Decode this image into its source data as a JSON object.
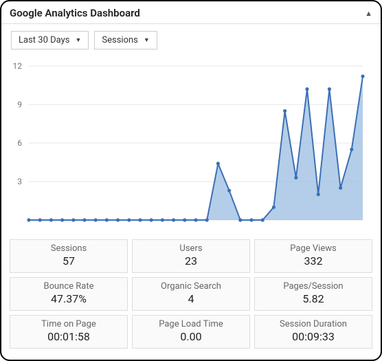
{
  "header": {
    "title": "Google Analytics Dashboard"
  },
  "controls": {
    "range": "Last 30 Days",
    "metric": "Sessions"
  },
  "chart_data": {
    "type": "area",
    "title": "",
    "xlabel": "",
    "ylabel": "",
    "ylim": [
      0,
      12
    ],
    "yticks": [
      3,
      6,
      9,
      12
    ],
    "series": [
      {
        "name": "Sessions",
        "values": [
          0,
          0,
          0,
          0,
          0,
          0,
          0,
          0,
          0,
          0,
          0,
          0,
          0,
          0,
          0,
          0,
          0,
          4.4,
          2.3,
          0,
          0,
          0,
          1,
          8.5,
          3.3,
          10.2,
          2,
          10.2,
          2.5,
          5.5,
          11.2
        ]
      }
    ]
  },
  "stats": [
    {
      "label": "Sessions",
      "value": "57"
    },
    {
      "label": "Users",
      "value": "23"
    },
    {
      "label": "Page Views",
      "value": "332"
    },
    {
      "label": "Bounce Rate",
      "value": "47.37%"
    },
    {
      "label": "Organic Search",
      "value": "4"
    },
    {
      "label": "Pages/Session",
      "value": "5.82"
    },
    {
      "label": "Time on Page",
      "value": "00:01:58"
    },
    {
      "label": "Page Load Time",
      "value": "0.00"
    },
    {
      "label": "Session Duration",
      "value": "00:09:33"
    }
  ]
}
